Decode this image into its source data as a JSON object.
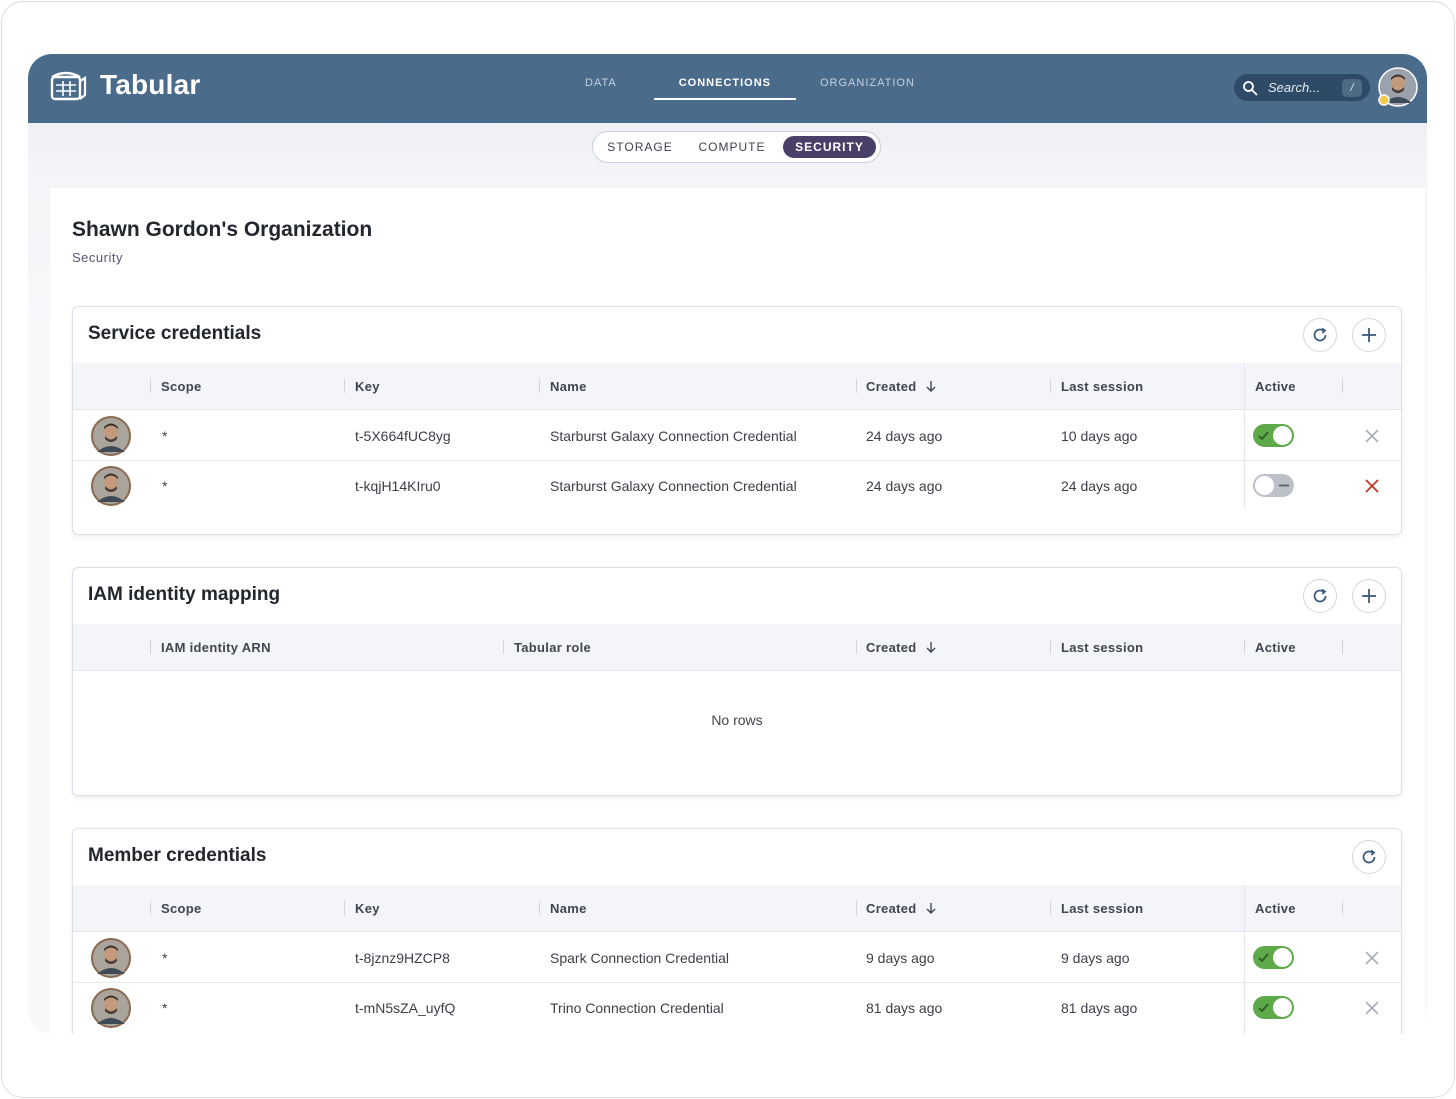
{
  "app": {
    "name": "Tabular"
  },
  "nav": {
    "items": [
      {
        "label": "DATA",
        "active": false
      },
      {
        "label": "CONNECTIONS",
        "active": true
      },
      {
        "label": "ORGANIZATION",
        "active": false
      }
    ]
  },
  "search": {
    "placeholder": "Search...",
    "shortcut": "/"
  },
  "subtabs": [
    {
      "label": "STORAGE",
      "active": false
    },
    {
      "label": "COMPUTE",
      "active": false
    },
    {
      "label": "SECURITY",
      "active": true
    }
  ],
  "page": {
    "title": "Shawn Gordon's Organization",
    "subtitle": "Security"
  },
  "service_credentials": {
    "title": "Service credentials",
    "columns": {
      "scope": "Scope",
      "key": "Key",
      "name": "Name",
      "created": "Created",
      "last_session": "Last session",
      "active": "Active"
    },
    "rows": [
      {
        "scope": "*",
        "key": "t-5X664fUC8yg",
        "name": "Starburst Galaxy Connection Credential",
        "created": "24 days ago",
        "last_session": "10 days ago",
        "active": true
      },
      {
        "scope": "*",
        "key": "t-kqjH14KIru0",
        "name": "Starburst Galaxy Connection Credential",
        "created": "24 days ago",
        "last_session": "24 days ago",
        "active": false
      }
    ]
  },
  "iam_mapping": {
    "title": "IAM identity mapping",
    "columns": {
      "arn": "IAM identity ARN",
      "role": "Tabular role",
      "created": "Created",
      "last_session": "Last session",
      "active": "Active"
    },
    "empty_text": "No rows"
  },
  "member_credentials": {
    "title": "Member credentials",
    "columns": {
      "scope": "Scope",
      "key": "Key",
      "name": "Name",
      "created": "Created",
      "last_session": "Last session",
      "active": "Active"
    },
    "rows": [
      {
        "scope": "*",
        "key": "t-8jznz9HZCP8",
        "name": "Spark Connection Credential",
        "created": "9 days ago",
        "last_session": "9 days ago",
        "active": true
      },
      {
        "scope": "*",
        "key": "t-mN5sZA_uyfQ",
        "name": "Trino Connection Credential",
        "created": "81 days ago",
        "last_session": "81 days ago",
        "active": true
      }
    ]
  },
  "colors": {
    "topbar": "#4a6b8a",
    "accent": "#4a3f68",
    "toggle_on": "#5ea94a",
    "delete_active": "#c0392b"
  }
}
